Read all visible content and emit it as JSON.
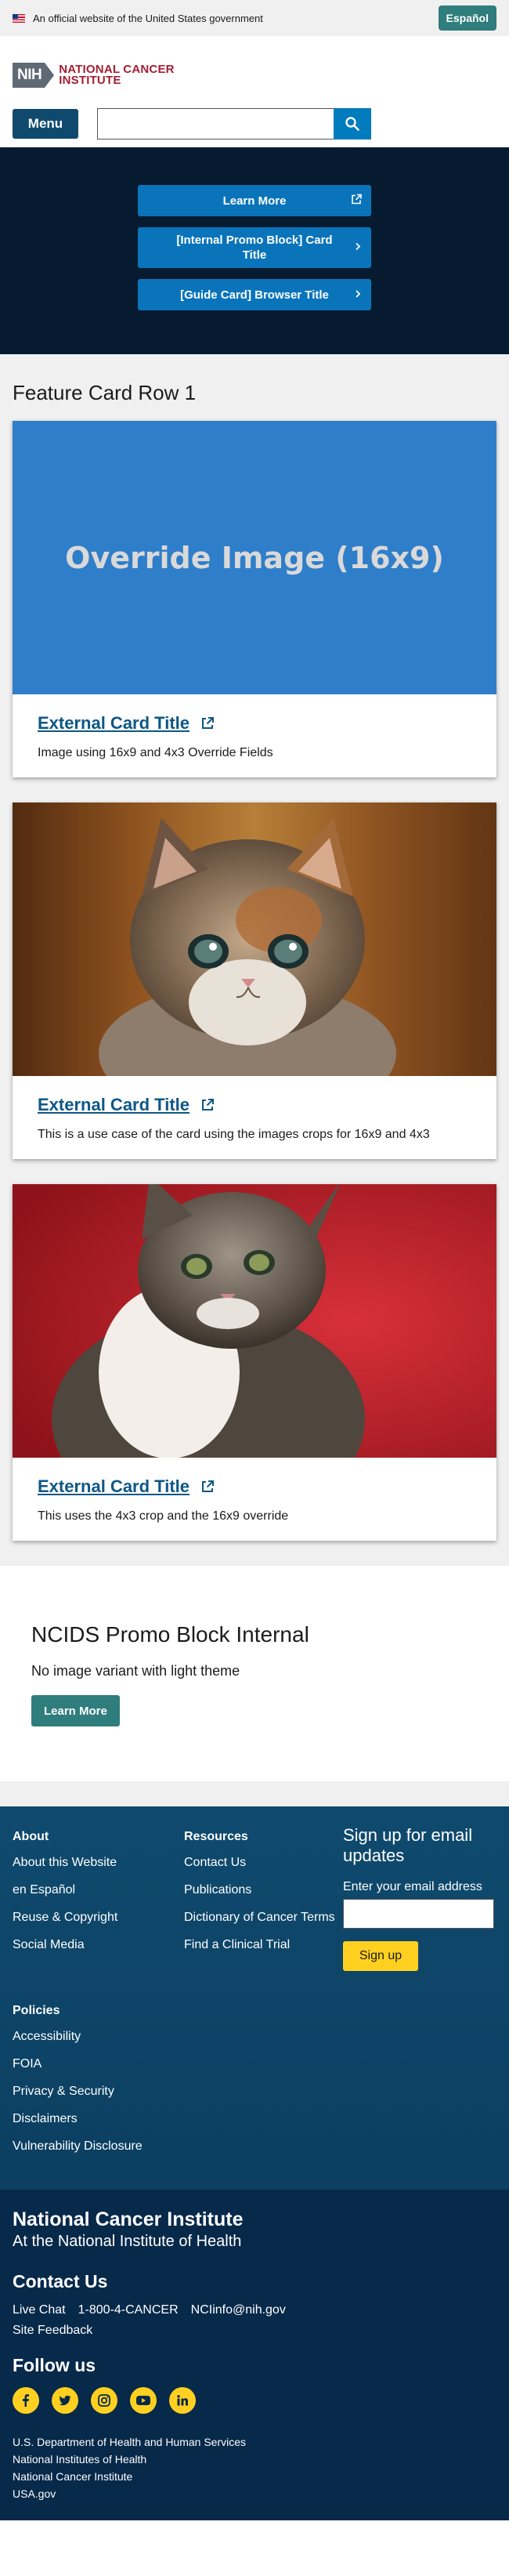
{
  "gov_banner": {
    "text": "An official website of the United States government",
    "espanol": "Español"
  },
  "header": {
    "nih_text": "NIH",
    "nci_line1": "NATIONAL CANCER",
    "nci_line2": "INSTITUTE",
    "menu_label": "Menu",
    "search_placeholder": ""
  },
  "dark_list": {
    "items": [
      {
        "label": "Learn More",
        "icon": "external-link-icon"
      },
      {
        "label": "[Internal Promo Block] Card Title",
        "icon": "chevron-right-icon"
      },
      {
        "label": "[Guide Card] Browser Title",
        "icon": "chevron-right-icon"
      }
    ]
  },
  "feature_row": {
    "title": "Feature Card Row 1",
    "cards": [
      {
        "image_text": "Override Image (16x9)",
        "title": "External Card Title",
        "description": "Image using 16x9 and 4x3 Override Fields"
      },
      {
        "title": "External Card Title",
        "description": "This is a use case of the card using the images crops for 16x9 and 4x3"
      },
      {
        "title": "External Card Title",
        "description": "This uses the 4x3 crop and the 16x9 override"
      }
    ]
  },
  "promo_block": {
    "title": "NCIDS Promo Block Internal",
    "text": "No image variant with light theme",
    "button": "Learn More"
  },
  "footer": {
    "about": {
      "heading": "About",
      "links": [
        "About this Website",
        "en Español",
        "Reuse & Copyright",
        "Social Media"
      ]
    },
    "resources": {
      "heading": "Resources",
      "links": [
        "Contact Us",
        "Publications",
        "Dictionary of Cancer Terms",
        "Find a Clinical Trial"
      ]
    },
    "policies": {
      "heading": "Policies",
      "links": [
        "Accessibility",
        "FOIA",
        "Privacy & Security",
        "Disclaimers",
        "Vulnerability Disclosure"
      ]
    },
    "signup": {
      "title": "Sign up for email updates",
      "label": "Enter your email address",
      "button": "Sign up"
    },
    "bottom": {
      "name": "National Cancer Institute",
      "sub": "At the National Institute of Health",
      "contact_title": "Contact Us",
      "live_chat": "Live Chat",
      "phone": "1-800-4-CANCER",
      "email": "NCIinfo@nih.gov",
      "site_feedback": "Site Feedback",
      "follow_title": "Follow us",
      "social": [
        "facebook-icon",
        "twitter-icon",
        "instagram-icon",
        "youtube-icon",
        "linkedin-icon"
      ],
      "agencies": [
        "U.S. Department of Health and Human Services",
        "National Institutes of Health",
        "National Cancer Institute",
        "USA.gov"
      ]
    }
  },
  "colors": {
    "brand_red": "#a31f34",
    "teal": "#2f7d7d",
    "dark_navy": "#071b30",
    "link_blue": "#0d5786",
    "button_blue": "#0a74bb",
    "footer_blue": "#0f4a6e",
    "signup_yellow": "#ffd020"
  }
}
